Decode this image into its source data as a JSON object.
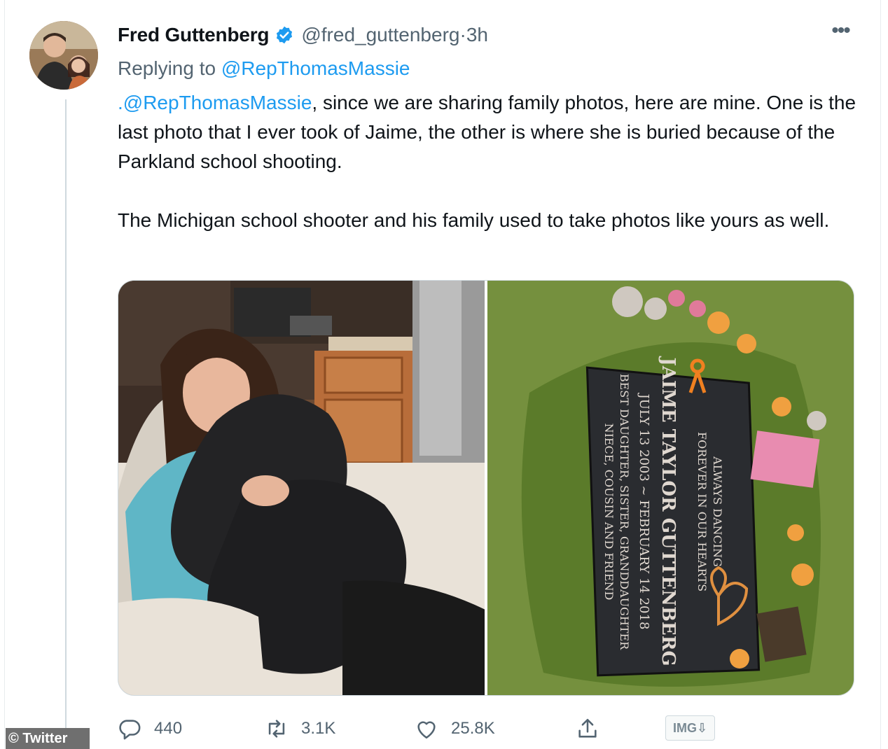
{
  "tweet": {
    "author_name": "Fred Guttenberg",
    "handle": "@fred_guttenberg",
    "separator": " · ",
    "time": "3h",
    "replying_prefix": "Replying to ",
    "replying_to": "@RepThomasMassie",
    "body_mention": ".@RepThomasMassie",
    "body_line1_rest": ", since we are sharing family photos, here are mine. One is the last photo that I ever took of Jaime, the other is where she is buried because of the Parkland school shooting.",
    "body_paragraph2": "The Michigan school shooter and his family used to take photos like yours as well.",
    "more_icon_glyph": "•••"
  },
  "media": {
    "left_photo": "girl-with-dog-photo",
    "right_photo": "gravestone-photo",
    "gravestone_lines": [
      "ALWAYS DANCING",
      "FOREVER IN OUR HEARTS",
      "JAIME TAYLOR GUTTENBERG",
      "JULY 13 2003 ~ FEBRUARY 14 2018",
      "BEST DAUGHTER, SISTER, GRANDDAUGHTER",
      "NIECE, COUSIN AND FRIEND"
    ]
  },
  "actions": {
    "reply_count": "440",
    "retweet_count": "3.1K",
    "like_count": "25.8K",
    "reply_icon": "reply-icon",
    "retweet_icon": "retweet-icon",
    "like_icon": "heart-icon",
    "share_icon": "share-icon"
  },
  "overlays": {
    "img_badge": "IMG⇩",
    "watermark": "© Twitter"
  },
  "colors": {
    "accent": "#1d9bf0",
    "secondary_text": "#536471",
    "primary_text": "#0f1419"
  }
}
